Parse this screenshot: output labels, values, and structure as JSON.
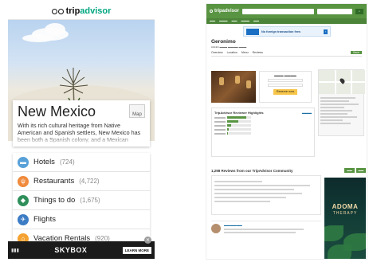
{
  "mobile": {
    "logo": {
      "prefix": "trip",
      "suffix": "advisor"
    },
    "place_title": "New Mexico",
    "map_label": "Map",
    "description": "With its rich cultural heritage from Native American and Spanish settlers, New Mexico has been both a Spanish colony, and a Mexican colony, and still",
    "categories": [
      {
        "label": "Hotels",
        "count": "(724)",
        "icon": "bed-icon",
        "color": "#58a0d8"
      },
      {
        "label": "Restaurants",
        "count": "(4,722)",
        "icon": "fork-knife-icon",
        "color": "#f08a3c"
      },
      {
        "label": "Things to do",
        "count": "(1,675)",
        "icon": "ticket-icon",
        "color": "#2f8f5b"
      },
      {
        "label": "Flights",
        "count": "",
        "icon": "plane-icon",
        "color": "#3c7cc4"
      },
      {
        "label": "Vacation Rentals",
        "count": "(920)",
        "icon": "house-icon",
        "color": "#f4a232"
      }
    ],
    "ad": {
      "brand": "SKYBOX",
      "button": "LEARN MORE"
    }
  },
  "desktop": {
    "logo": "tripadvisor",
    "banner_text": "No foreign transaction fees",
    "restaurant_name": "Geronimo",
    "tabs": [
      "Overview",
      "Location",
      "Menu",
      "Reviews"
    ],
    "save_label": "Save",
    "reserve_label": "Reserve now",
    "reviews_heading": "TripAdvisor Reviewer Highlights",
    "community_heading": "1,298 Reviews from our TripAdvisor Community",
    "ad_title": "ADOMA",
    "ad_subtitle": "THERAPY"
  }
}
